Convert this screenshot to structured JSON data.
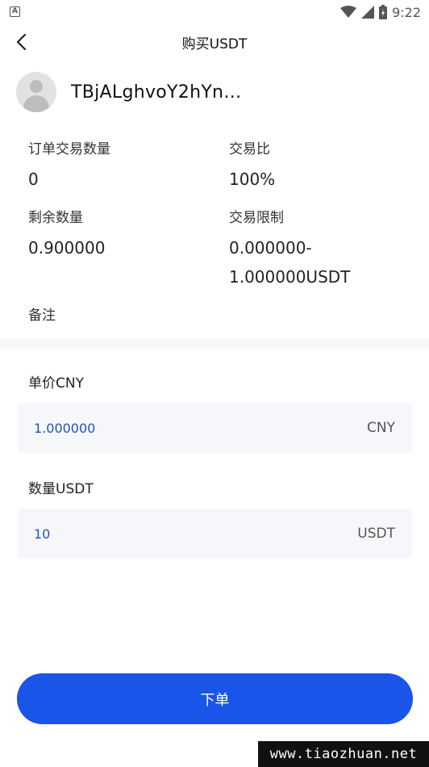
{
  "status_bar": {
    "time": "9:22",
    "notification_icon_letter": "A",
    "icons": [
      "wifi-icon",
      "signal-icon",
      "battery-icon"
    ]
  },
  "header": {
    "title": "购买USDT",
    "back_icon": "chevron-left-icon"
  },
  "seller": {
    "name": "TBjALghvoY2hYn…"
  },
  "order_info": {
    "order_volume_label": "订单交易数量",
    "order_volume_value": "0",
    "trade_ratio_label": "交易比",
    "trade_ratio_value": "100%",
    "remaining_label": "剩余数量",
    "remaining_value": "0.900000",
    "limit_label": "交易限制",
    "limit_value_line1": "0.000000-",
    "limit_value_line2": "1.000000USDT",
    "remark_label": "备注"
  },
  "form": {
    "price_label": "单价CNY",
    "price_value": "1.000000",
    "price_unit": "CNY",
    "amount_label": "数量USDT",
    "amount_value": "10",
    "amount_unit": "USDT"
  },
  "submit_label": "下单",
  "watermark": "www.tiaozhuan.net",
  "colors": {
    "accent": "#1955e8",
    "input_text": "#1f52c8",
    "input_bg": "#f6f7fa"
  }
}
